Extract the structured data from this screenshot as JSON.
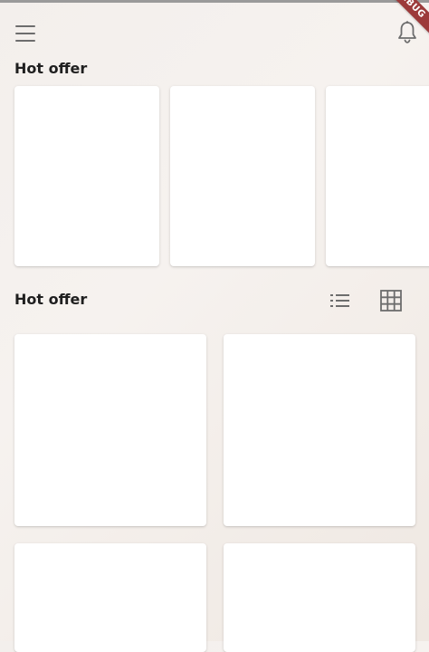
{
  "debug_banner": "DEBUG",
  "header": {
    "menu_icon": "hamburger-menu-icon",
    "notification_icon": "bell-icon"
  },
  "sections": {
    "hot_offer_carousel": {
      "title": "Hot offer"
    },
    "hot_offer_grid": {
      "title": "Hot offer",
      "list_view_icon": "list-view-icon",
      "grid_view_icon": "grid-view-icon"
    }
  },
  "colors": {
    "background": "#f3efec",
    "card": "#ffffff",
    "icon": "#6d6d6d",
    "debug_banner": "#9c3a3a"
  }
}
